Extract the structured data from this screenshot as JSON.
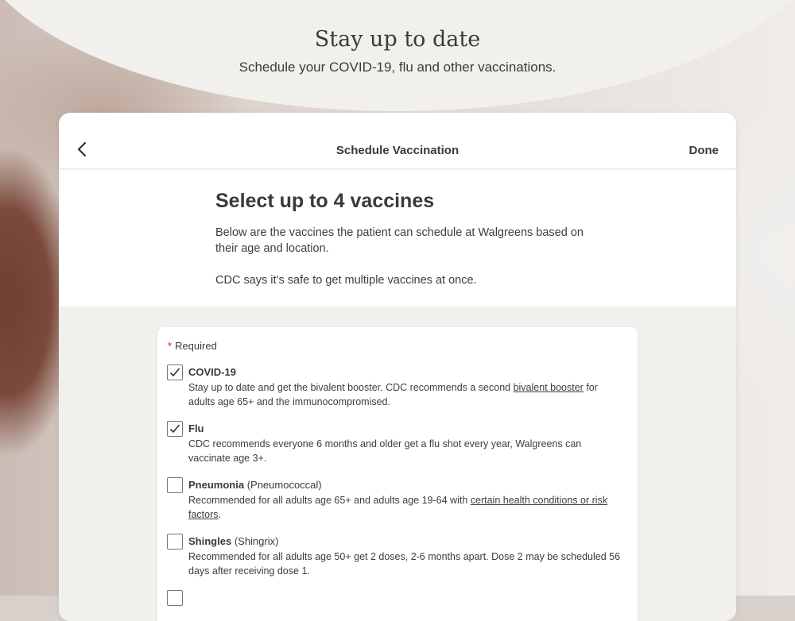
{
  "hero": {
    "title": "Stay up to date",
    "subtitle": "Schedule your COVID-19, flu and other vaccinations."
  },
  "topbar": {
    "back_icon": "chevron-left-icon",
    "title": "Schedule Vaccination",
    "done_label": "Done"
  },
  "intro": {
    "heading": "Select up to 4 vaccines",
    "paragraph1": "Below are the vaccines the patient can schedule at Walgreens based on their age and location.",
    "paragraph2": "CDC says it’s safe to get multiple vaccines at once."
  },
  "form": {
    "required_star": "*",
    "required_label": "Required",
    "vaccines": [
      {
        "name": "COVID-19",
        "qualifier": "",
        "checked": true,
        "desc_before": "Stay up to date and get the bivalent booster. CDC recommends a second ",
        "desc_link": "bivalent booster",
        "desc_after": " for adults age 65+ and the immunocompromised."
      },
      {
        "name": "Flu",
        "qualifier": "",
        "checked": true,
        "desc_before": "CDC recommends everyone 6 months and older get a flu shot every year, Walgreens can vaccinate age 3+.",
        "desc_link": "",
        "desc_after": ""
      },
      {
        "name": "Pneumonia",
        "qualifier": "(Pneumococcal)",
        "checked": false,
        "desc_before": "Recommended for all adults age 65+ and adults age 19-64 with ",
        "desc_link": "certain health conditions or risk factors",
        "desc_after": "."
      },
      {
        "name": "Shingles",
        "qualifier": "(Shingrix)",
        "checked": false,
        "desc_before": "Recommended for all adults age 50+ get 2 doses, 2-6 months apart. Dose 2 may be scheduled 56 days after receiving dose 1.",
        "desc_link": "",
        "desc_after": ""
      }
    ]
  },
  "colors": {
    "required_star": "#c8102e",
    "hero_bg": "#f2f0ec",
    "section_bg": "#f2f0ec"
  }
}
